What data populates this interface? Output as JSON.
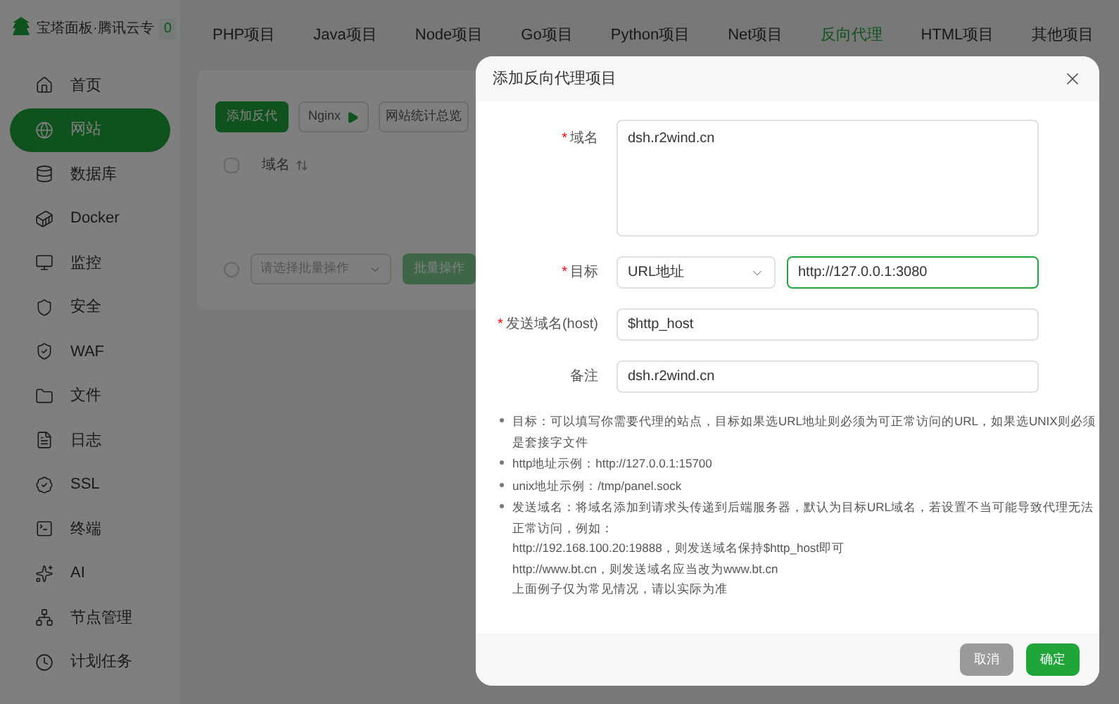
{
  "sidebar": {
    "title": "宝塔面板·腾讯云专",
    "badge": "0",
    "items": [
      {
        "label": "首页",
        "selected": false
      },
      {
        "label": "网站",
        "selected": true
      },
      {
        "label": "数据库",
        "selected": false
      },
      {
        "label": "Docker",
        "selected": false
      },
      {
        "label": "监控",
        "selected": false
      },
      {
        "label": "安全",
        "selected": false
      },
      {
        "label": "WAF",
        "selected": false
      },
      {
        "label": "文件",
        "selected": false
      },
      {
        "label": "日志",
        "selected": false
      },
      {
        "label": "SSL",
        "selected": false
      },
      {
        "label": "终端",
        "selected": false
      },
      {
        "label": "AI",
        "selected": false
      },
      {
        "label": "节点管理",
        "selected": false
      },
      {
        "label": "计划任务",
        "selected": false
      }
    ]
  },
  "tabs": [
    {
      "label": "PHP项目",
      "selected": false
    },
    {
      "label": "Java项目",
      "selected": false
    },
    {
      "label": "Node项目",
      "selected": false
    },
    {
      "label": "Go项目",
      "selected": false
    },
    {
      "label": "Python项目",
      "selected": false
    },
    {
      "label": "Net项目",
      "selected": false
    },
    {
      "label": "反向代理",
      "selected": true
    },
    {
      "label": "HTML项目",
      "selected": false
    },
    {
      "label": "其他项目",
      "selected": false
    }
  ],
  "toolbar": {
    "add_button": "添加反代",
    "nginx_button": "Nginx",
    "stats_button": "网站统计总览"
  },
  "table": {
    "header_checkbox_checked": false,
    "select_all_checked": false,
    "column_header": "域名",
    "bulk_select_placeholder": "请选择批量操作",
    "bulk_button": "批量操作"
  },
  "dialog": {
    "title": "添加反向代理项目",
    "required_mark": "*",
    "fields": [
      {
        "kind": "textarea",
        "label": "域名",
        "required": true,
        "value": "dsh.r2wind.cn"
      },
      {
        "kind": "select_input",
        "label": "目标",
        "required": true,
        "select": "URL地址",
        "value": "http://127.0.0.1:3080",
        "focused": true
      },
      {
        "kind": "input",
        "label": "发送域名(host)",
        "required": true,
        "value": "$http_host",
        "focused": false
      },
      {
        "kind": "input",
        "label": "备注",
        "required": false,
        "value": "dsh.r2wind.cn",
        "focused": false
      }
    ],
    "hints": [
      {
        "lines": [
          "目标：可以填写你需要代理的站点，目标如果选URL地址则必须为可正常访问的URL，如果选UNIX则必须",
          "是套接字文件"
        ]
      },
      {
        "lines": [
          "http地址示例：http://127.0.0.1:15700"
        ]
      },
      {
        "lines": [
          "unix地址示例：/tmp/panel.sock"
        ]
      },
      {
        "lines": [
          "发送域名：将域名添加到请求头传递到后端服务器，默认为目标URL域名，若设置不当可能导致代理无法",
          "正常访问，例如：",
          "http://192.168.100.20:19888，则发送域名保持$http_host即可",
          "http://www.bt.cn，则发送域名应当改为www.bt.cn",
          "上面例子仅为常见情况，请以实际为准"
        ]
      }
    ],
    "cancel_button": "取消",
    "confirm_button": "确定"
  }
}
